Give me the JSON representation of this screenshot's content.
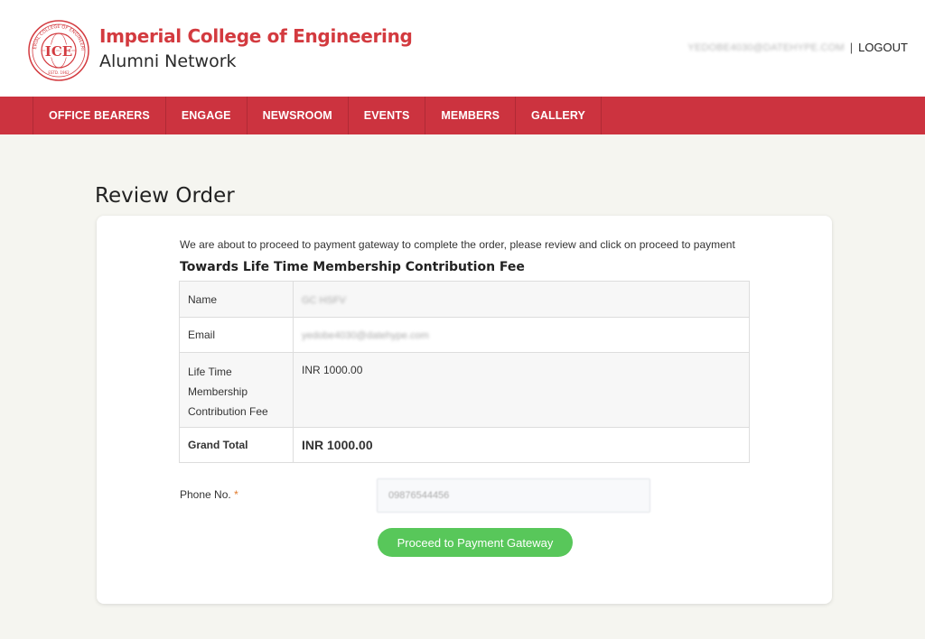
{
  "header": {
    "seal": {
      "abbr": "ICE",
      "ring_text": "IMPERIAL COLLEGE OF ENGINEERING",
      "estd": "ESTD. 1962"
    },
    "college_name": "Imperial College of Engineering",
    "network_name": "Alumni Network",
    "user_email": "YEDOBE4030@DATEHYPE.COM",
    "separator": "|",
    "logout_label": "LOGOUT"
  },
  "nav": {
    "items": [
      {
        "label": "OFFICE BEARERS"
      },
      {
        "label": "ENGAGE"
      },
      {
        "label": "NEWSROOM"
      },
      {
        "label": "EVENTS"
      },
      {
        "label": "MEMBERS"
      },
      {
        "label": "GALLERY"
      }
    ]
  },
  "page": {
    "title": "Review Order"
  },
  "order": {
    "intro": "We are about to proceed to payment gateway to complete the order, please review and click on proceed to payment",
    "heading": "Towards Life Time Membership Contribution Fee",
    "rows": {
      "name": {
        "label": "Name",
        "value": "GC HSFV"
      },
      "email": {
        "label": "Email",
        "value": "yedobe4030@datehype.com"
      },
      "fee": {
        "label_line1": "Life Time",
        "label_line2": "Membership",
        "label_line3": "Contribution Fee",
        "value": "INR 1000.00"
      },
      "total": {
        "label": "Grand Total",
        "value": "INR 1000.00"
      }
    },
    "phone": {
      "label": "Phone No.",
      "required_mark": "*",
      "value": "09876544456"
    },
    "proceed_label": "Proceed to Payment Gateway"
  },
  "colors": {
    "brand_red": "#d33a3f",
    "nav_red": "#cc333f",
    "button_green": "#58c75a",
    "page_bg": "#f5f5f0"
  }
}
